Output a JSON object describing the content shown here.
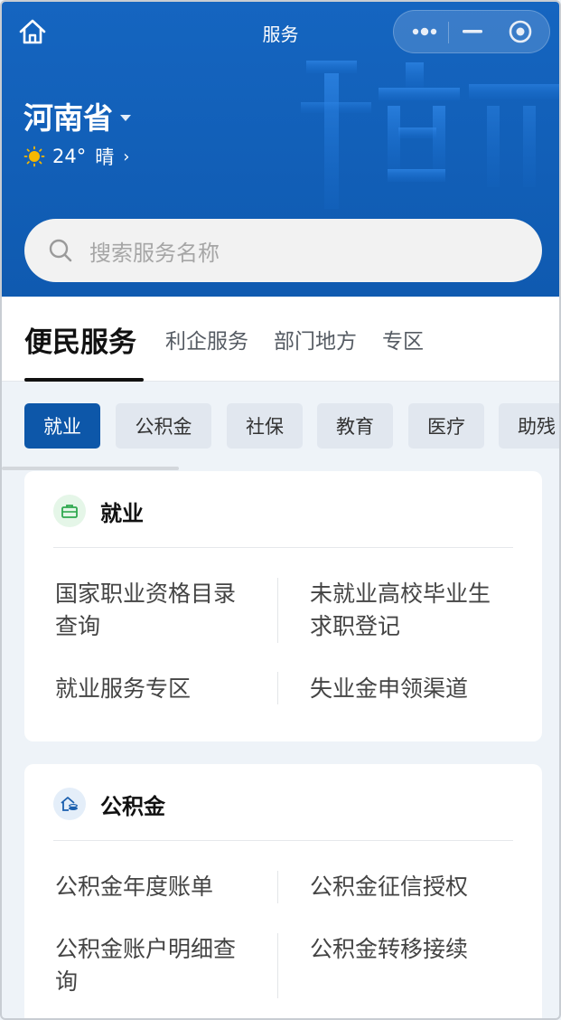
{
  "topbar": {
    "title": "服务",
    "home_icon": "home-icon",
    "menu_icons": [
      "more-dots-icon",
      "minimize-icon",
      "close-circle-icon"
    ]
  },
  "location": {
    "province": "河南省",
    "temperature": "24°",
    "condition": "晴",
    "weather_icon": "sun-icon"
  },
  "search": {
    "placeholder": "搜索服务名称"
  },
  "tabs": [
    {
      "label": "便民服务",
      "active": true
    },
    {
      "label": "利企服务",
      "active": false
    },
    {
      "label": "部门地方",
      "active": false
    },
    {
      "label": "专区",
      "active": false
    }
  ],
  "chips": [
    {
      "label": "就业",
      "active": true
    },
    {
      "label": "公积金",
      "active": false
    },
    {
      "label": "社保",
      "active": false
    },
    {
      "label": "教育",
      "active": false
    },
    {
      "label": "医疗",
      "active": false
    },
    {
      "label": "助残",
      "active": false
    }
  ],
  "sections": [
    {
      "title": "就业",
      "icon": "briefcase-icon",
      "items": [
        "国家职业资格目录查询",
        "未就业高校毕业生求职登记",
        "就业服务专区",
        "失业金申领渠道"
      ]
    },
    {
      "title": "公积金",
      "icon": "housing-fund-icon",
      "items": [
        "公积金年度账单",
        "公积金征信授权",
        "公积金账户明细查询",
        "公积金转移接续"
      ]
    }
  ],
  "colors": {
    "header_blue": "#1565c0",
    "active_chip": "#0d57a9",
    "sun": "#f5b800"
  }
}
